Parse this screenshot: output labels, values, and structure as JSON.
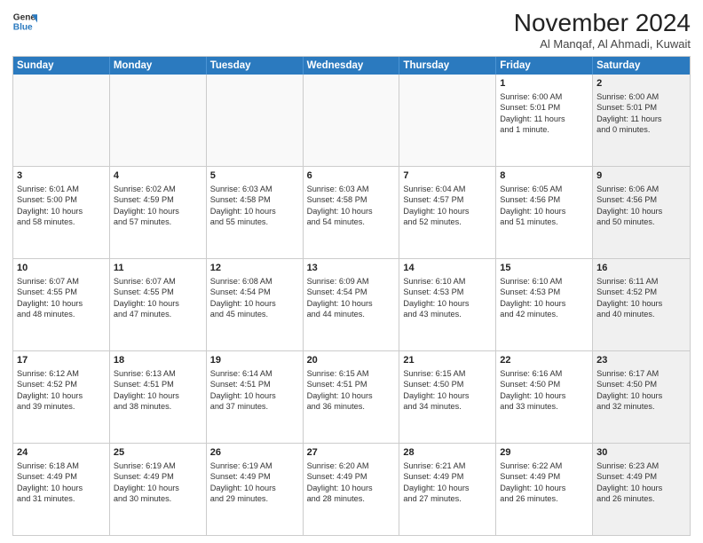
{
  "logo": {
    "line1": "General",
    "line2": "Blue",
    "icon_color": "#2b7abf"
  },
  "title": "November 2024",
  "location": "Al Manqaf, Al Ahmadi, Kuwait",
  "header_days": [
    "Sunday",
    "Monday",
    "Tuesday",
    "Wednesday",
    "Thursday",
    "Friday",
    "Saturday"
  ],
  "rows": [
    [
      {
        "day": "",
        "info": "",
        "shaded": false,
        "empty": true
      },
      {
        "day": "",
        "info": "",
        "shaded": false,
        "empty": true
      },
      {
        "day": "",
        "info": "",
        "shaded": false,
        "empty": true
      },
      {
        "day": "",
        "info": "",
        "shaded": false,
        "empty": true
      },
      {
        "day": "",
        "info": "",
        "shaded": false,
        "empty": true
      },
      {
        "day": "1",
        "info": "Sunrise: 6:00 AM\nSunset: 5:01 PM\nDaylight: 11 hours\nand 1 minute.",
        "shaded": false,
        "empty": false
      },
      {
        "day": "2",
        "info": "Sunrise: 6:00 AM\nSunset: 5:01 PM\nDaylight: 11 hours\nand 0 minutes.",
        "shaded": true,
        "empty": false
      }
    ],
    [
      {
        "day": "3",
        "info": "Sunrise: 6:01 AM\nSunset: 5:00 PM\nDaylight: 10 hours\nand 58 minutes.",
        "shaded": false,
        "empty": false
      },
      {
        "day": "4",
        "info": "Sunrise: 6:02 AM\nSunset: 4:59 PM\nDaylight: 10 hours\nand 57 minutes.",
        "shaded": false,
        "empty": false
      },
      {
        "day": "5",
        "info": "Sunrise: 6:03 AM\nSunset: 4:58 PM\nDaylight: 10 hours\nand 55 minutes.",
        "shaded": false,
        "empty": false
      },
      {
        "day": "6",
        "info": "Sunrise: 6:03 AM\nSunset: 4:58 PM\nDaylight: 10 hours\nand 54 minutes.",
        "shaded": false,
        "empty": false
      },
      {
        "day": "7",
        "info": "Sunrise: 6:04 AM\nSunset: 4:57 PM\nDaylight: 10 hours\nand 52 minutes.",
        "shaded": false,
        "empty": false
      },
      {
        "day": "8",
        "info": "Sunrise: 6:05 AM\nSunset: 4:56 PM\nDaylight: 10 hours\nand 51 minutes.",
        "shaded": false,
        "empty": false
      },
      {
        "day": "9",
        "info": "Sunrise: 6:06 AM\nSunset: 4:56 PM\nDaylight: 10 hours\nand 50 minutes.",
        "shaded": true,
        "empty": false
      }
    ],
    [
      {
        "day": "10",
        "info": "Sunrise: 6:07 AM\nSunset: 4:55 PM\nDaylight: 10 hours\nand 48 minutes.",
        "shaded": false,
        "empty": false
      },
      {
        "day": "11",
        "info": "Sunrise: 6:07 AM\nSunset: 4:55 PM\nDaylight: 10 hours\nand 47 minutes.",
        "shaded": false,
        "empty": false
      },
      {
        "day": "12",
        "info": "Sunrise: 6:08 AM\nSunset: 4:54 PM\nDaylight: 10 hours\nand 45 minutes.",
        "shaded": false,
        "empty": false
      },
      {
        "day": "13",
        "info": "Sunrise: 6:09 AM\nSunset: 4:54 PM\nDaylight: 10 hours\nand 44 minutes.",
        "shaded": false,
        "empty": false
      },
      {
        "day": "14",
        "info": "Sunrise: 6:10 AM\nSunset: 4:53 PM\nDaylight: 10 hours\nand 43 minutes.",
        "shaded": false,
        "empty": false
      },
      {
        "day": "15",
        "info": "Sunrise: 6:10 AM\nSunset: 4:53 PM\nDaylight: 10 hours\nand 42 minutes.",
        "shaded": false,
        "empty": false
      },
      {
        "day": "16",
        "info": "Sunrise: 6:11 AM\nSunset: 4:52 PM\nDaylight: 10 hours\nand 40 minutes.",
        "shaded": true,
        "empty": false
      }
    ],
    [
      {
        "day": "17",
        "info": "Sunrise: 6:12 AM\nSunset: 4:52 PM\nDaylight: 10 hours\nand 39 minutes.",
        "shaded": false,
        "empty": false
      },
      {
        "day": "18",
        "info": "Sunrise: 6:13 AM\nSunset: 4:51 PM\nDaylight: 10 hours\nand 38 minutes.",
        "shaded": false,
        "empty": false
      },
      {
        "day": "19",
        "info": "Sunrise: 6:14 AM\nSunset: 4:51 PM\nDaylight: 10 hours\nand 37 minutes.",
        "shaded": false,
        "empty": false
      },
      {
        "day": "20",
        "info": "Sunrise: 6:15 AM\nSunset: 4:51 PM\nDaylight: 10 hours\nand 36 minutes.",
        "shaded": false,
        "empty": false
      },
      {
        "day": "21",
        "info": "Sunrise: 6:15 AM\nSunset: 4:50 PM\nDaylight: 10 hours\nand 34 minutes.",
        "shaded": false,
        "empty": false
      },
      {
        "day": "22",
        "info": "Sunrise: 6:16 AM\nSunset: 4:50 PM\nDaylight: 10 hours\nand 33 minutes.",
        "shaded": false,
        "empty": false
      },
      {
        "day": "23",
        "info": "Sunrise: 6:17 AM\nSunset: 4:50 PM\nDaylight: 10 hours\nand 32 minutes.",
        "shaded": true,
        "empty": false
      }
    ],
    [
      {
        "day": "24",
        "info": "Sunrise: 6:18 AM\nSunset: 4:49 PM\nDaylight: 10 hours\nand 31 minutes.",
        "shaded": false,
        "empty": false
      },
      {
        "day": "25",
        "info": "Sunrise: 6:19 AM\nSunset: 4:49 PM\nDaylight: 10 hours\nand 30 minutes.",
        "shaded": false,
        "empty": false
      },
      {
        "day": "26",
        "info": "Sunrise: 6:19 AM\nSunset: 4:49 PM\nDaylight: 10 hours\nand 29 minutes.",
        "shaded": false,
        "empty": false
      },
      {
        "day": "27",
        "info": "Sunrise: 6:20 AM\nSunset: 4:49 PM\nDaylight: 10 hours\nand 28 minutes.",
        "shaded": false,
        "empty": false
      },
      {
        "day": "28",
        "info": "Sunrise: 6:21 AM\nSunset: 4:49 PM\nDaylight: 10 hours\nand 27 minutes.",
        "shaded": false,
        "empty": false
      },
      {
        "day": "29",
        "info": "Sunrise: 6:22 AM\nSunset: 4:49 PM\nDaylight: 10 hours\nand 26 minutes.",
        "shaded": false,
        "empty": false
      },
      {
        "day": "30",
        "info": "Sunrise: 6:23 AM\nSunset: 4:49 PM\nDaylight: 10 hours\nand 26 minutes.",
        "shaded": true,
        "empty": false
      }
    ]
  ]
}
